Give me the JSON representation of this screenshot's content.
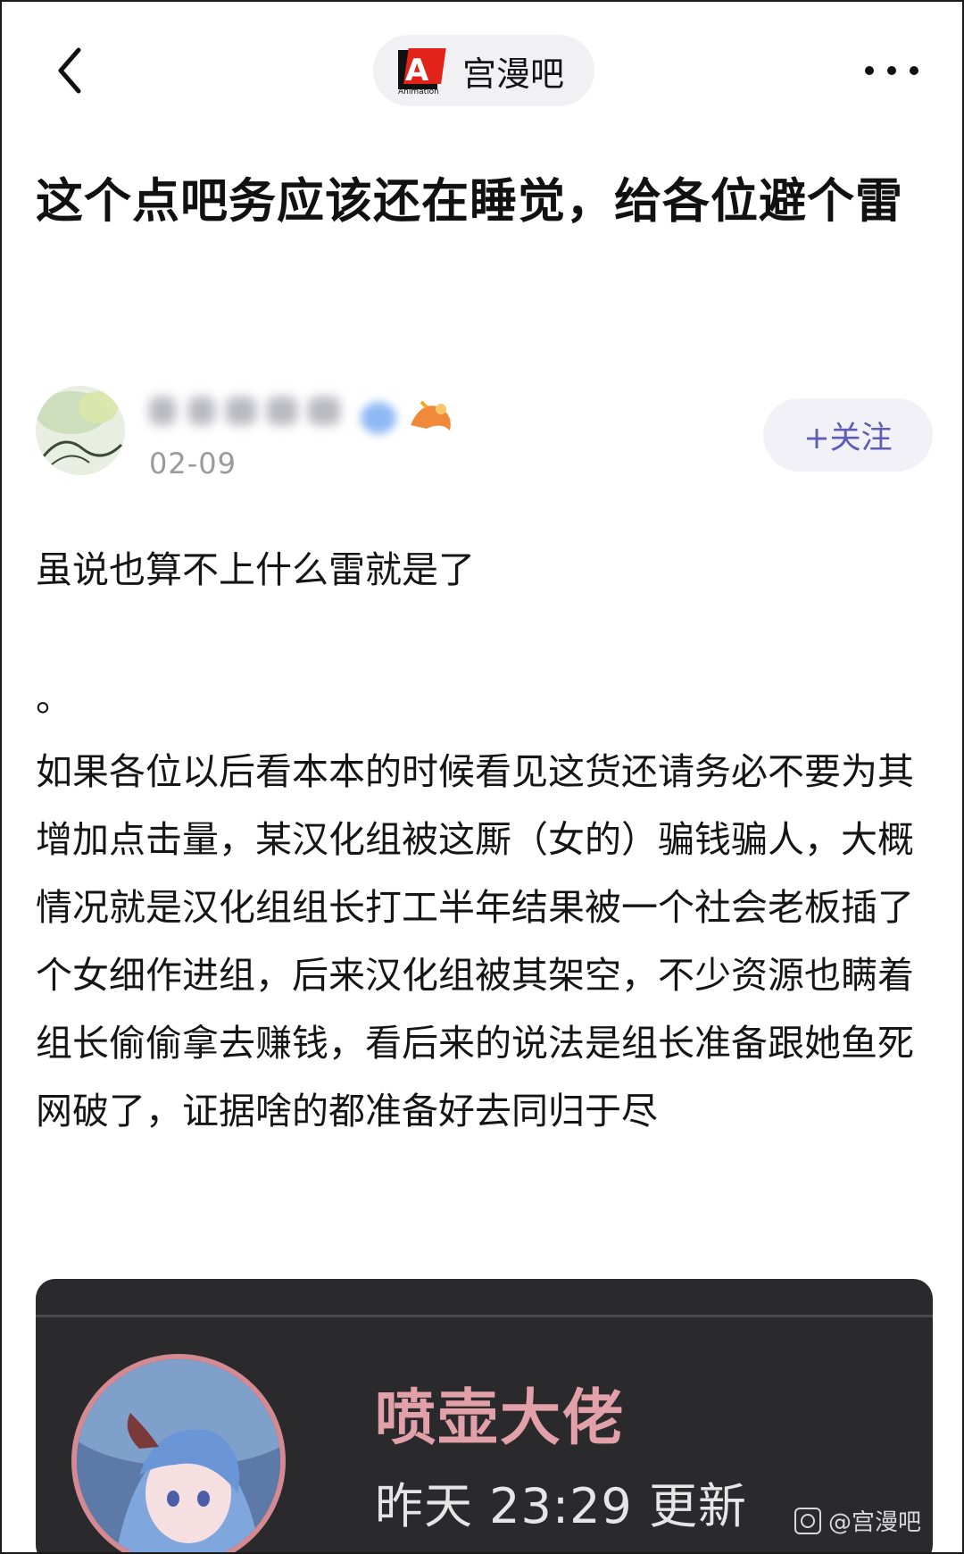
{
  "header": {
    "forum_name": "宫漫吧",
    "logo_letter": "A",
    "logo_text": "Animation"
  },
  "post": {
    "title": "这个点吧务应该还在睡觉，给各位避个雷",
    "date": "02-09",
    "follow_label": "+关注",
    "paragraphs": [
      "虽说也算不上什么雷就是了",
      "。",
      "如果各位以后看本本的时候看见这货还请务必不要为其增加点击量，某汉化组被这厮（女的）骗钱骗人，大概情况就是汉化组组长打工半年结果被一个社会老板插了个女细作进组，后来汉化组被其架空，不少资源也瞒着组长偷偷拿去赚钱，看后来的说法是组长准备跟她鱼死网破了，证据啥的都准备好去同归于尽"
    ]
  },
  "embedded_image": {
    "name": "喷壶大佬",
    "update_text": "昨天 23:29 更新",
    "watermark": "@宫漫吧"
  },
  "icons": {
    "back": "chevron-left-icon",
    "more": "more-dots-icon",
    "logo": "forum-logo-icon",
    "watermark": "tieba-icon"
  },
  "colors": {
    "follow_text": "#5f5bb8",
    "follow_bg": "#f1f1f7",
    "pill_bg": "#f1f1f3",
    "embed_bg": "#2a2a2c",
    "embed_name": "#e2a0a8"
  }
}
